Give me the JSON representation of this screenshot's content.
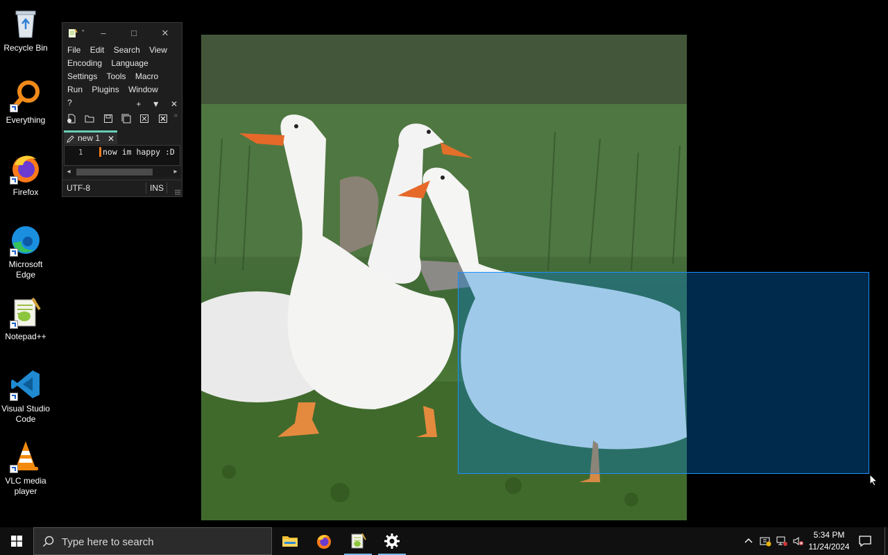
{
  "desktop": {
    "icons": [
      {
        "label": "Recycle Bin"
      },
      {
        "label": "Everything"
      },
      {
        "label": "Firefox"
      },
      {
        "label": "Microsoft Edge"
      },
      {
        "label": "Notepad++"
      },
      {
        "label": "Visual Studio Code"
      },
      {
        "label": "VLC media player"
      }
    ]
  },
  "notepad": {
    "title_marker": "*",
    "menu": [
      "File",
      "Edit",
      "Search",
      "View",
      "Encoding",
      "Language",
      "Settings",
      "Tools",
      "Macro",
      "Run",
      "Plugins",
      "Window",
      "?"
    ],
    "tab_controls": {
      "add": "+",
      "list": "▼",
      "close": "✕"
    },
    "tab": {
      "label": "new 1",
      "close": "✕"
    },
    "editor": {
      "line_number": "1",
      "text": "now im happy :D"
    },
    "status": {
      "encoding": "UTF-8",
      "mode": "INS"
    }
  },
  "taskbar": {
    "search_placeholder": "Type here to search",
    "apps": [
      "file-explorer",
      "firefox",
      "notepad++",
      "settings"
    ],
    "clock": {
      "time": "5:34 PM",
      "date": "11/24/2024"
    },
    "tray_chevron": "^"
  },
  "colors": {
    "selection_fill": "#0078d7",
    "taskbar_active_underline": "#76b9ed",
    "npp_tab_accent": "#6bcfb8"
  }
}
